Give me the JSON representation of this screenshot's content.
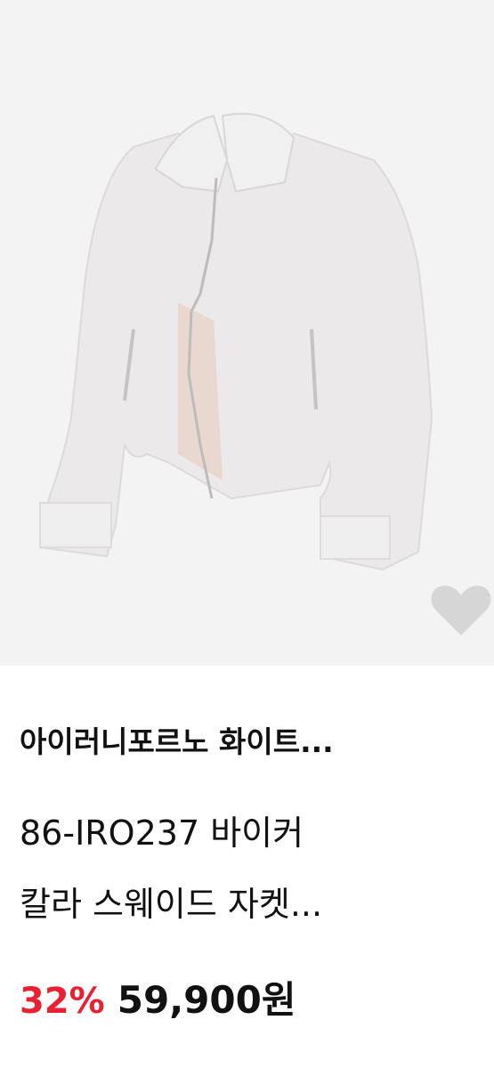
{
  "product": {
    "brand_title": "아이러니포르노 화이트...",
    "desc_line1": "86-IRO237 바이커",
    "desc_line2": "칼라 스웨이드 자켓...",
    "discount": "32%",
    "price": "59,900원"
  },
  "icons": {
    "like": "heart-icon"
  },
  "colors": {
    "discount": "#e8202f",
    "text": "#111111",
    "heart": "#d6d6d6",
    "image_bg": "#f3f3f3"
  }
}
